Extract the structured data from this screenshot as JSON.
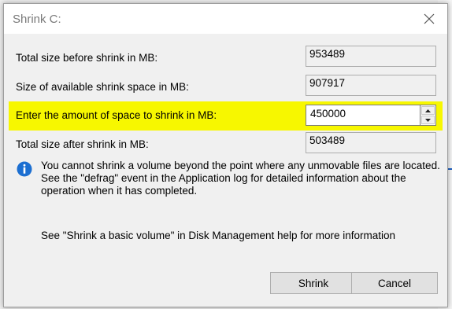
{
  "window": {
    "title": "Shrink C:"
  },
  "rows": {
    "total_before_label": "Total size before shrink in MB:",
    "total_before_value": "953489",
    "available_label": "Size of available shrink space in MB:",
    "available_value": "907917",
    "amount_label": "Enter the amount of space to shrink in MB:",
    "amount_value": "450000",
    "total_after_label": "Total size after shrink in MB:",
    "total_after_value": "503489"
  },
  "info": {
    "message": "You cannot shrink a volume beyond the point where any unmovable files are located. See the \"defrag\" event in the Application log for detailed information about the operation when it has completed.",
    "help": "See \"Shrink a basic volume\" in Disk Management help for more information"
  },
  "buttons": {
    "shrink": "Shrink",
    "cancel": "Cancel"
  },
  "colors": {
    "highlight": "#f7f700",
    "info_icon": "#1c6fd1",
    "dialog_bg": "#f0f0f0"
  },
  "icons": {
    "close": "close-icon",
    "info": "info-icon",
    "spin_up": "chevron-up-icon",
    "spin_down": "chevron-down-icon"
  }
}
